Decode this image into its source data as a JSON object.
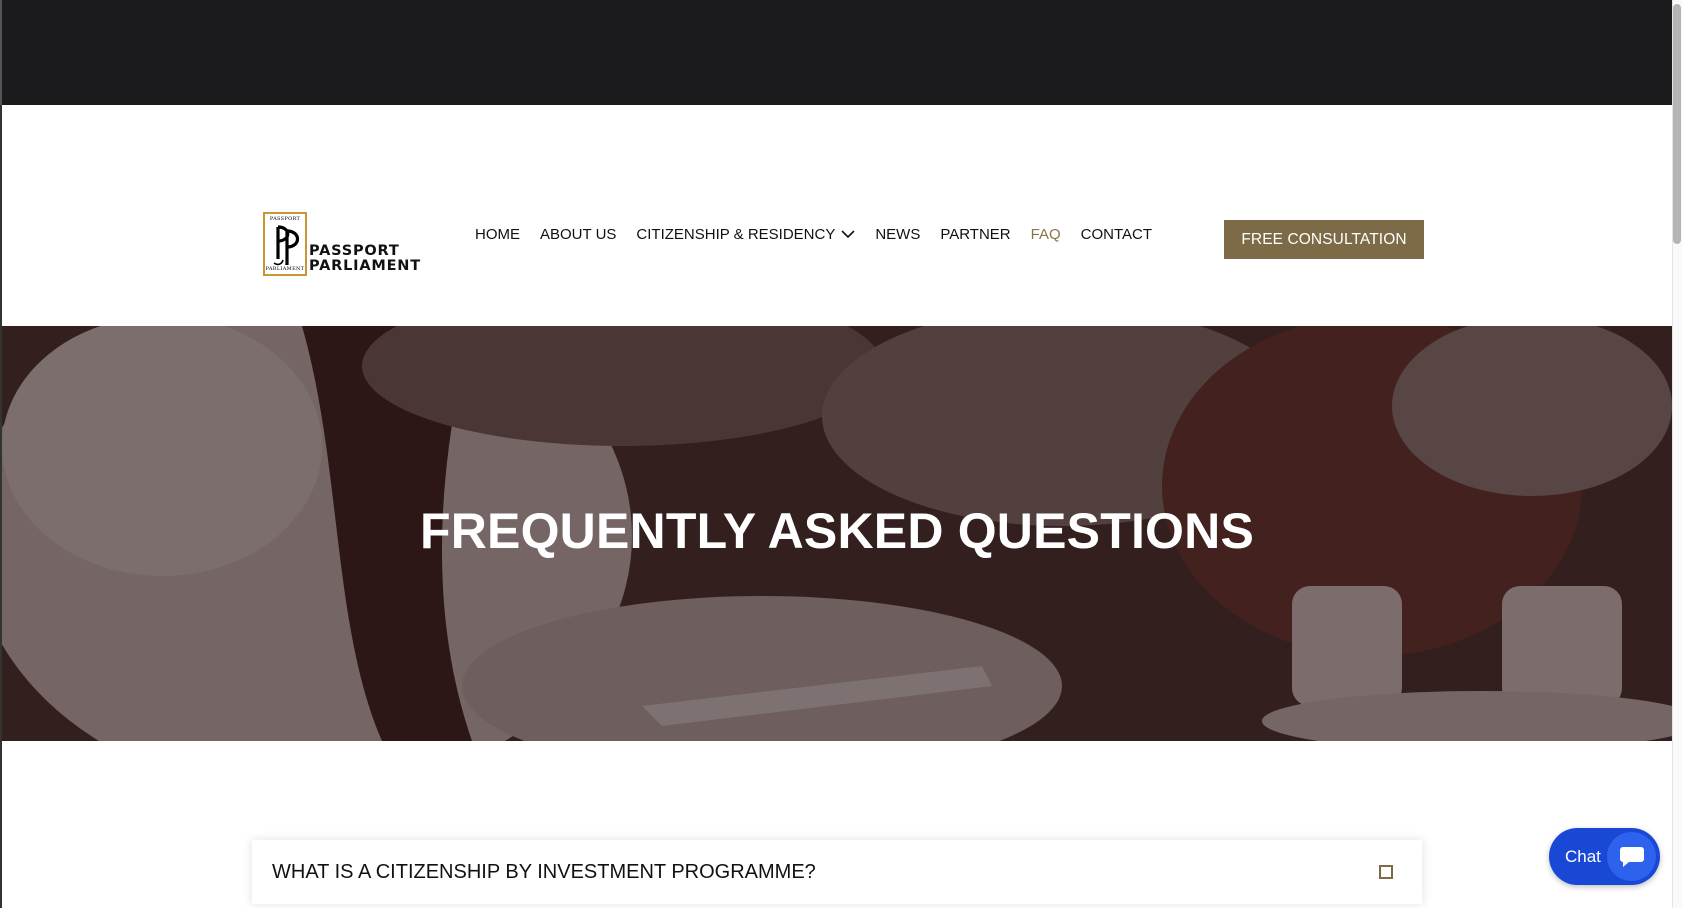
{
  "brand": {
    "name_line1": "PASSPORT",
    "name_line2": "PARLIAMENT",
    "mark_top": "PASSPORT",
    "mark_bottom": "PARLIAMENT",
    "accent_color": "#7c6b46"
  },
  "nav": {
    "items": [
      {
        "label": "HOME"
      },
      {
        "label": "ABOUT US"
      },
      {
        "label": "CITIZENSHIP & RESIDENCY",
        "has_dropdown": true
      },
      {
        "label": "NEWS"
      },
      {
        "label": "PARTNER"
      },
      {
        "label": "FAQ",
        "active": true
      },
      {
        "label": "CONTACT"
      }
    ],
    "active_color": "#8a7448"
  },
  "cta": {
    "label": "FREE CONSULTATION"
  },
  "hero": {
    "title": "FREQUENTLY ASKED QUESTIONS"
  },
  "faq": {
    "items": [
      {
        "question": "WHAT IS A CITIZENSHIP BY INVESTMENT PROGRAMME?",
        "toggle_icon": "square-outline-icon"
      }
    ]
  },
  "chat": {
    "label": "Chat",
    "icon": "chat-bubble-icon",
    "color": "#1a48d6"
  }
}
